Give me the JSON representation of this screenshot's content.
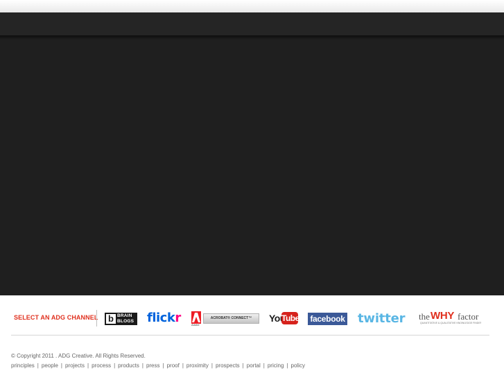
{
  "channels": {
    "heading": "SELECT AN ADG CHANNEL",
    "logos": [
      {
        "name": "brain-blogs",
        "text_top": "BRAIN",
        "text_bottom": "BLOGS",
        "mark": "b"
      },
      {
        "name": "flickr",
        "part1": "flick",
        "part2": "r"
      },
      {
        "name": "adobe-acrobat-connect",
        "adobe": "Adobe",
        "label": "ACROBAT® CONNECT™"
      },
      {
        "name": "youtube",
        "you": "You",
        "tube": "Tube"
      },
      {
        "name": "facebook",
        "text": "facebook"
      },
      {
        "name": "twitter",
        "text": "twitter"
      },
      {
        "name": "the-why-factor",
        "the": "the",
        "why": "WHY",
        "factor": "factor",
        "tagline": "QUANTITATIVE & QUALITATIVE KNOWLEDGE FINDERS"
      }
    ],
    "colors": {
      "accent": "#e0301e",
      "facebook": "#3b5998",
      "twitter": "#59b6e4",
      "youtube": "#d6221c",
      "flickr_blue": "#0063dc",
      "flickr_pink": "#ff0084"
    }
  },
  "footer": {
    "copyright": "© Copyright 2011 . ADG Creative. All Rights Reserved.",
    "links": [
      "principles",
      "people",
      "projects",
      "process",
      "products",
      "press",
      "proof",
      "proximity",
      "prospects",
      "portal",
      "pricing",
      "policy"
    ]
  }
}
